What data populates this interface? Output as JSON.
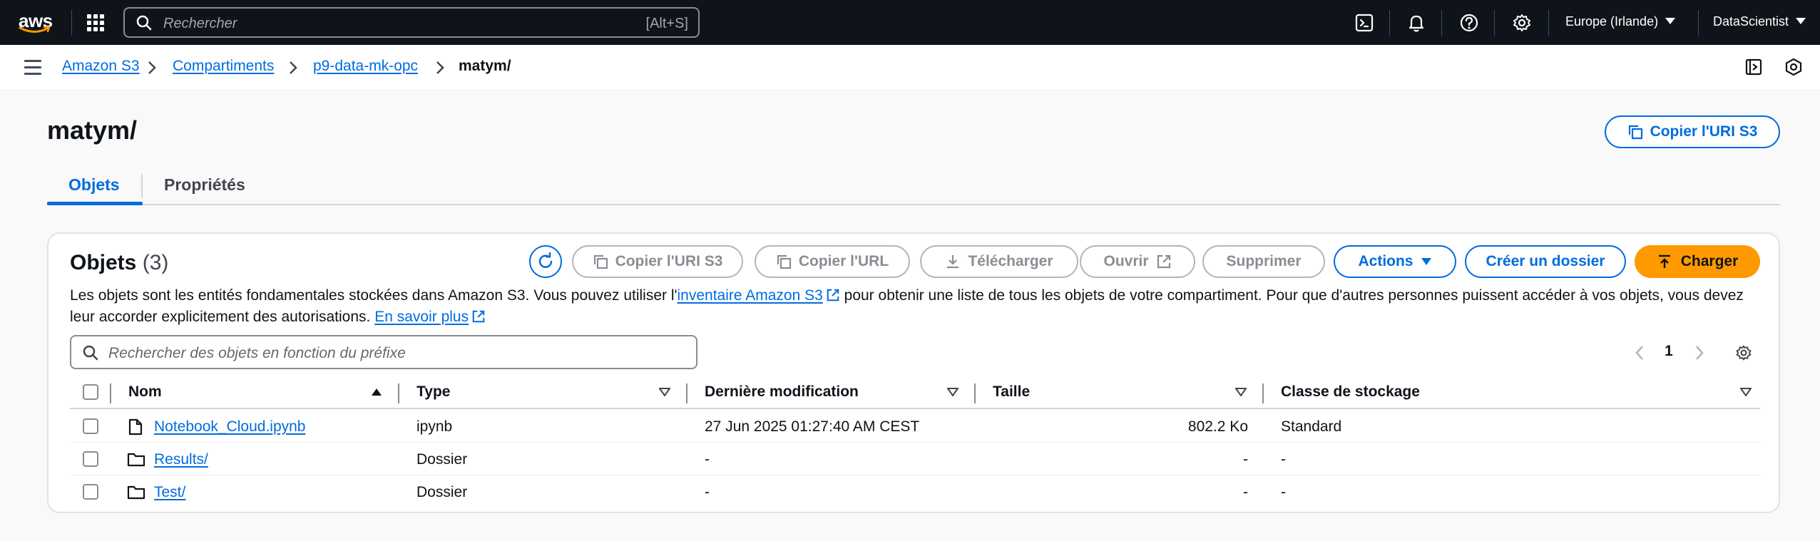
{
  "topnav": {
    "logo": "aws",
    "search_placeholder": "Rechercher",
    "search_shortcut": "[Alt+S]",
    "region": "Europe (Irlande)",
    "user": "DataScientist",
    "icons": [
      "cloudshell-icon",
      "bell-icon",
      "help-icon",
      "settings-icon"
    ]
  },
  "breadcrumb": {
    "items": [
      "Amazon S3",
      "Compartiments",
      "p9-data-mk-opc"
    ],
    "current": "matym/"
  },
  "page": {
    "title": "matym/",
    "copy_uri_button": "Copier l'URI S3"
  },
  "tabs": [
    {
      "label": "Objets",
      "active": true
    },
    {
      "label": "Propriétés",
      "active": false
    }
  ],
  "objects_panel": {
    "title": "Objets",
    "count": "(3)",
    "buttons": {
      "copy_uri": "Copier l'URI S3",
      "copy_url": "Copier l'URL",
      "download": "Télécharger",
      "open": "Ouvrir",
      "delete": "Supprimer",
      "actions": "Actions",
      "create_folder": "Créer un dossier",
      "upload": "Charger"
    },
    "description": {
      "part1": "Les objets sont les entités fondamentales stockées dans Amazon S3. Vous pouvez utiliser l'",
      "link1": "inventaire Amazon S3",
      "part2": " pour obtenir une liste de tous les objets de votre compartiment. Pour que d'autres personnes puissent accéder à vos objets, vous devez leur accorder explicitement des autorisations. ",
      "link2": "En savoir plus"
    },
    "search_placeholder": "Rechercher des objets en fonction du préfixe",
    "page_number": "1",
    "columns": {
      "name": "Nom",
      "type": "Type",
      "modified": "Dernière modification",
      "size": "Taille",
      "storage": "Classe de stockage"
    },
    "rows": [
      {
        "icon": "file-icon",
        "name": "Notebook_Cloud.ipynb",
        "type": "ipynb",
        "modified": "27 Jun 2025 01:27:40 AM CEST",
        "size": "802.2 Ko",
        "storage": "Standard"
      },
      {
        "icon": "folder-icon",
        "name": "Results/",
        "type": "Dossier",
        "modified": "-",
        "size": "-",
        "storage": "-"
      },
      {
        "icon": "folder-icon",
        "name": "Test/",
        "type": "Dossier",
        "modified": "-",
        "size": "-",
        "storage": "-"
      }
    ]
  },
  "colors": {
    "nav_bg": "#0f141a",
    "link_blue": "#006ce0",
    "primary_orange": "#ff9900",
    "disabled_border": "#b4b4bb",
    "page_bg": "#f9f9fa"
  }
}
